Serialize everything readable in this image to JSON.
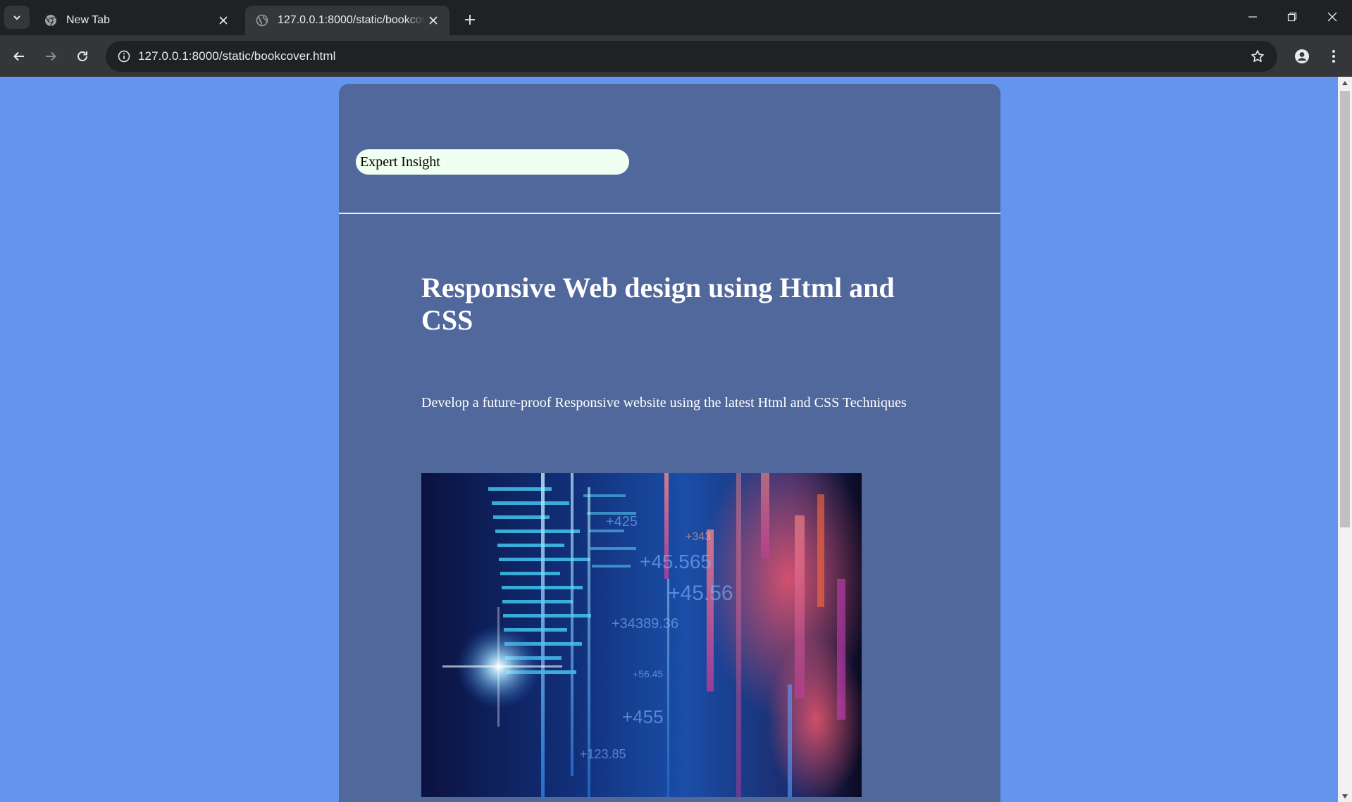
{
  "browser": {
    "tabs": [
      {
        "title": "New Tab",
        "active": false,
        "favicon": "chrome-icon"
      },
      {
        "title": "127.0.0.1:8000/static/bookcover.html",
        "active": true,
        "favicon": "globe-icon"
      }
    ],
    "url": "127.0.0.1:8000/static/bookcover.html"
  },
  "page": {
    "badge_text": "Expert Insight",
    "title": "Responsive Web design using Html and CSS",
    "subtitle": "Develop a future-proof Responsive website using the latest Html and CSS Techniques",
    "cover_image": {
      "description_icon": "code-data-visualization-image",
      "numbers": [
        "+425",
        "+45.565",
        "+34389.36",
        "+56.45",
        "+455",
        "+123.85",
        "+343",
        "+45.56"
      ]
    }
  },
  "colors": {
    "page_background": "#6495ed",
    "card_background": "#51689c",
    "badge_background": "#f0fff0",
    "text": "#ffffff",
    "chrome_dark": "#202124",
    "chrome_toolbar": "#35363a"
  }
}
